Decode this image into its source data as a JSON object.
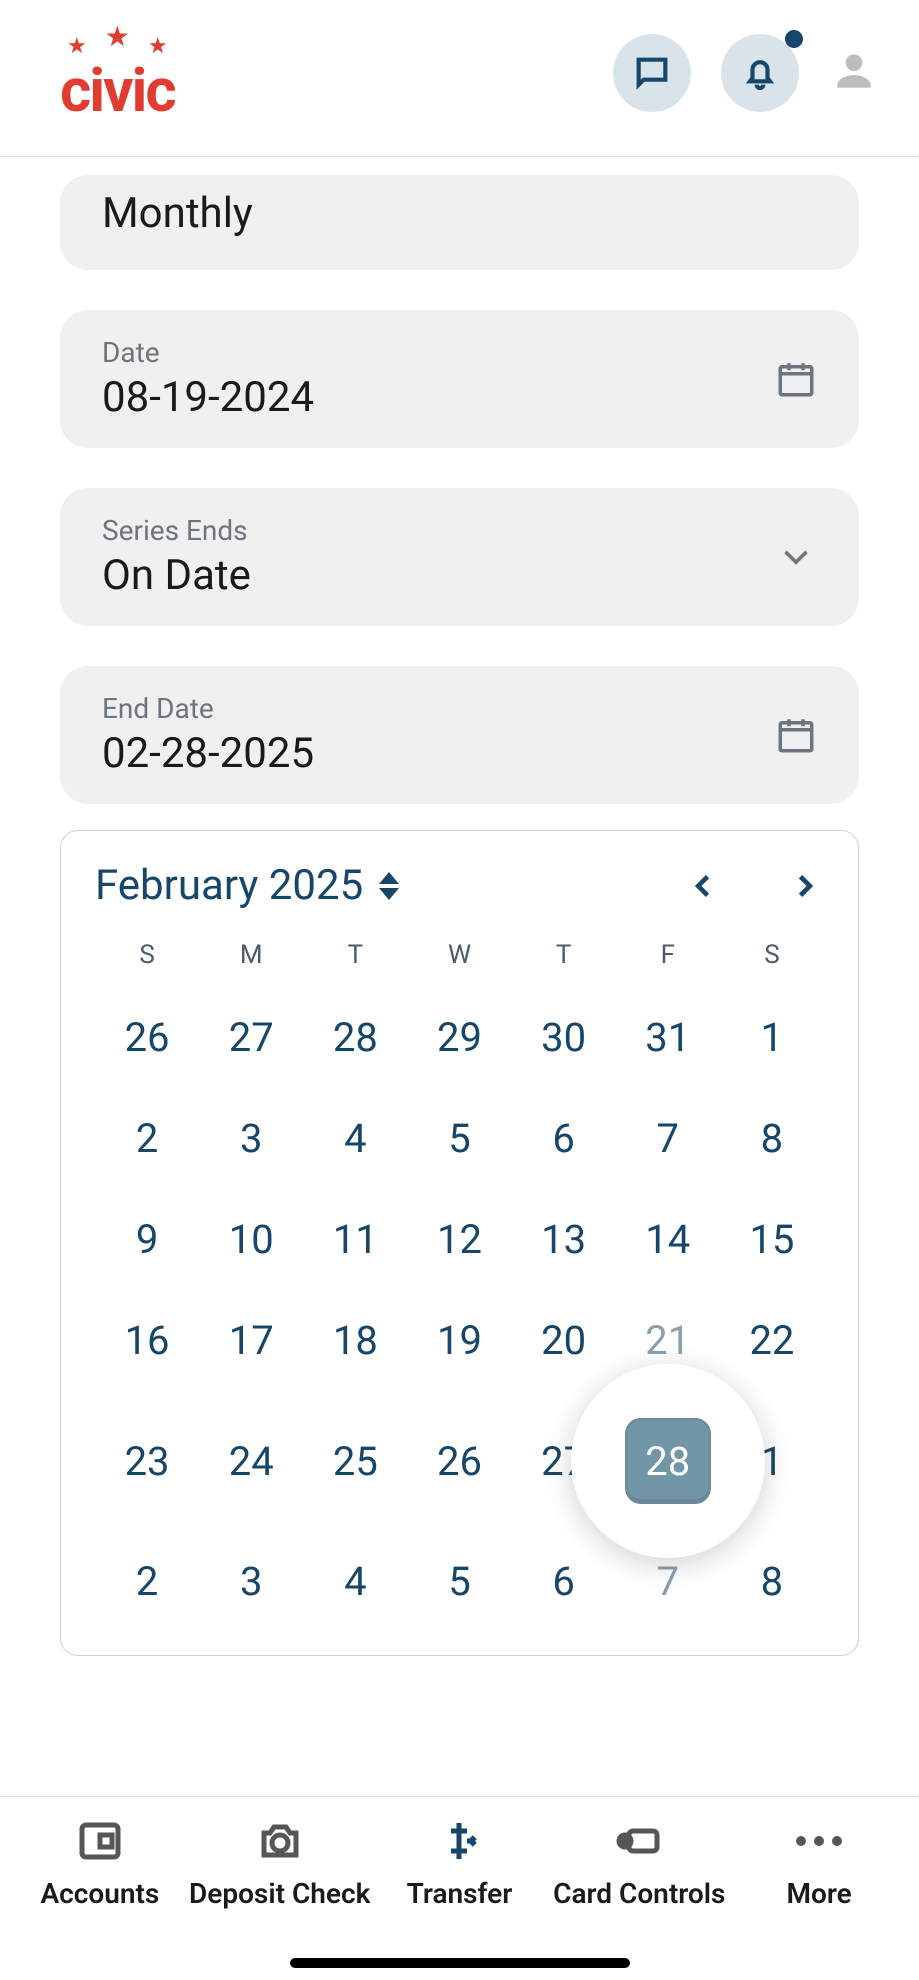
{
  "header": {
    "logo_text": "civic"
  },
  "fields": {
    "frequency": {
      "value": "Monthly"
    },
    "date": {
      "label": "Date",
      "value": "08-19-2024"
    },
    "series_ends": {
      "label": "Series Ends",
      "value": "On Date"
    },
    "end_date": {
      "label": "End Date",
      "value": "02-28-2025"
    }
  },
  "calendar": {
    "month_label": "February 2025",
    "dow": [
      "S",
      "M",
      "T",
      "W",
      "T",
      "F",
      "S"
    ],
    "weeks": [
      [
        {
          "d": "26",
          "o": false
        },
        {
          "d": "27",
          "o": false
        },
        {
          "d": "28",
          "o": false
        },
        {
          "d": "29",
          "o": false
        },
        {
          "d": "30",
          "o": false
        },
        {
          "d": "31",
          "o": false
        },
        {
          "d": "1",
          "o": false
        }
      ],
      [
        {
          "d": "2",
          "o": false
        },
        {
          "d": "3",
          "o": false
        },
        {
          "d": "4",
          "o": false
        },
        {
          "d": "5",
          "o": false
        },
        {
          "d": "6",
          "o": false
        },
        {
          "d": "7",
          "o": false
        },
        {
          "d": "8",
          "o": false
        }
      ],
      [
        {
          "d": "9",
          "o": false
        },
        {
          "d": "10",
          "o": false
        },
        {
          "d": "11",
          "o": false
        },
        {
          "d": "12",
          "o": false
        },
        {
          "d": "13",
          "o": false
        },
        {
          "d": "14",
          "o": false
        },
        {
          "d": "15",
          "o": false
        }
      ],
      [
        {
          "d": "16",
          "o": false
        },
        {
          "d": "17",
          "o": false
        },
        {
          "d": "18",
          "o": false
        },
        {
          "d": "19",
          "o": false
        },
        {
          "d": "20",
          "o": false
        },
        {
          "d": "21",
          "o": true
        },
        {
          "d": "22",
          "o": false
        }
      ],
      [
        {
          "d": "23",
          "o": false
        },
        {
          "d": "24",
          "o": false
        },
        {
          "d": "25",
          "o": false
        },
        {
          "d": "26",
          "o": false
        },
        {
          "d": "27",
          "o": false
        },
        {
          "d": "28",
          "o": false,
          "sel": true
        },
        {
          "d": "1",
          "o": false
        }
      ],
      [
        {
          "d": "2",
          "o": false
        },
        {
          "d": "3",
          "o": false
        },
        {
          "d": "4",
          "o": false
        },
        {
          "d": "5",
          "o": false
        },
        {
          "d": "6",
          "o": false
        },
        {
          "d": "7",
          "o": true
        },
        {
          "d": "8",
          "o": false
        }
      ]
    ]
  },
  "nav": {
    "accounts": "Accounts",
    "deposit": "Deposit Check",
    "transfer": "Transfer",
    "card": "Card Controls",
    "more": "More"
  }
}
